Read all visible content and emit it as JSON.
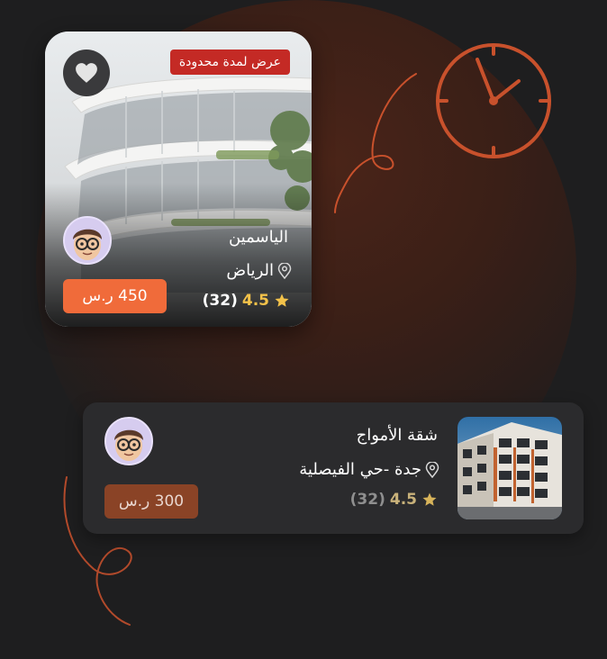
{
  "colors": {
    "accent": "#f06b3a",
    "badge": "#c42a25",
    "background": "#1e1e1f",
    "star": "#f3c24a"
  },
  "featured": {
    "badge": "عرض لمدة محدودة",
    "title": "الياسمين",
    "location": "الرياض",
    "rating": "4.5",
    "reviews": "(32)",
    "price": "450 ر.س",
    "icons": [
      "heart-icon",
      "location-pin-icon",
      "star-icon"
    ]
  },
  "listing": {
    "title": "شقة الأمواج",
    "location": "جدة -حي الفيصلية",
    "rating": "4.5",
    "reviews": "(32)",
    "price": "300 ر.س"
  }
}
